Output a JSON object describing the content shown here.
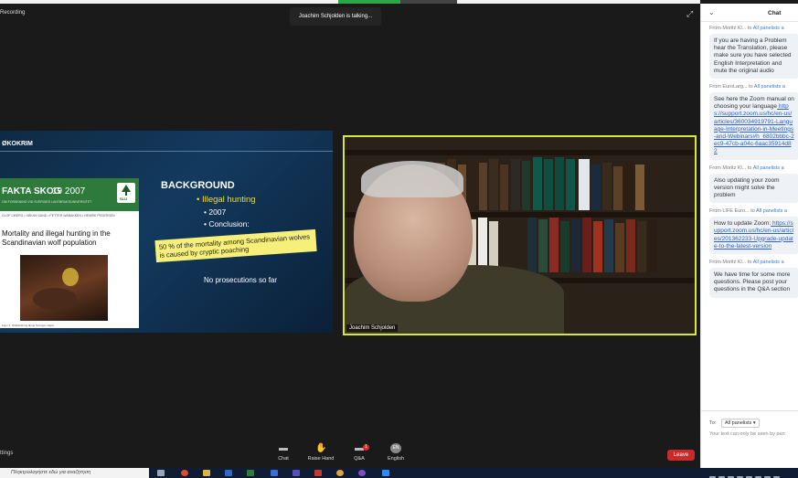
{
  "meeting": {
    "recording_label": "Recording",
    "talking_indicator": "Joachim Schjolden is talking...",
    "expand_icon": "expand-icon"
  },
  "slide": {
    "org": "ØKOKRIM",
    "doc_title": "FAKTA SKOG",
    "doc_issue": "19 2007",
    "doc_sub": "OM FORSKNING VID SVERIGES LANTBRUKSUNIVERSITET",
    "doc_logo_text": "SLU",
    "doc_authors": "OLOF LIBERG • HÅKAN SAND • PETTER WABAKKEN • HENRIK PEDERSEN",
    "doc_heading": "Mortality and illegal hunting in the Scandinavian wolf population",
    "doc_caption": "Figur 1. Wolfskötning längs Sveriges vägar",
    "background_title": "BACKGROUND",
    "bullet_1": "• Illegal hunting",
    "bullet_2": "• 2007",
    "bullet_3": "• Conclusion:",
    "callout": "50 % of the mortality among Scandinavian wolves is caused by cryptic poaching",
    "no_prosecutions": "No prosecutions so far"
  },
  "video": {
    "name_tag": "Joachim Schjolden",
    "border_color": "#d6e83a"
  },
  "toolbar": {
    "settings_label": "ttings",
    "chat_label": "Chat",
    "raise_hand_label": "Raise Hand",
    "qa_label": "Q&A",
    "qa_badge": "1",
    "language_label": "English",
    "language_icon_text": "EN",
    "leave_label": "Leave",
    "leave_color": "#c92a2a"
  },
  "taskbar": {
    "search_placeholder": "Πληκτρολογήστε εδώ για αναζήτηση"
  },
  "chat": {
    "title": "Chat",
    "messages": [
      {
        "from": "From Moritz Kl...",
        "to": "to",
        "recipient": "All panelists a",
        "text": "If you are having a Problem hear the Translation, please make sure you have selected English Interpretation and mute the original audio",
        "link": ""
      },
      {
        "from": "From EuroLarg...",
        "to": "to",
        "recipient": "All panelists a",
        "text": "See here the Zoom manual on choosing your language",
        "link": "https://support.zoom.us/hc/en-us/articles/360034919791-Language-Interpretation-in-Meetings-and-Webinars#h_6802bbbc-2ec9-47cb-a04c-6aac35914d82"
      },
      {
        "from": "From Moritz Kl...",
        "to": "to",
        "recipient": "All panelists a",
        "text": "Also updating your zoom version might solve the problem",
        "link": ""
      },
      {
        "from": "From LIFE Euro...",
        "to": "to",
        "recipient": "All panelists a",
        "text": "How to update Zoom:",
        "link": "https://support.zoom.us/hc/en-us/articles/201362233-Upgrade-update-to-the-latest-version"
      },
      {
        "from": "From Moritz Kl...",
        "to": "to",
        "recipient": "All panelists a",
        "text": "We have time for some more questions. Please post your questions in the Q&A section",
        "link": ""
      }
    ],
    "footer_to_label": "To:",
    "footer_to_value": "All panelists ▾",
    "input_placeholder": "Your text can only be seen by pan"
  }
}
